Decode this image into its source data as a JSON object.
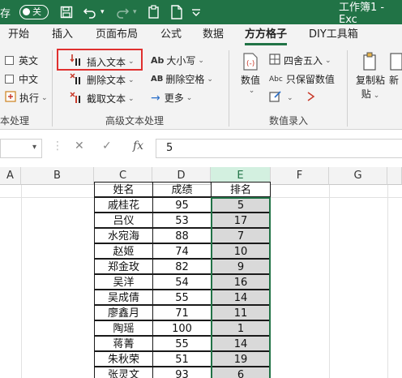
{
  "titlebar": {
    "autosave_label": "存",
    "toggle_text": "关",
    "title": "工作簿1 - Exc"
  },
  "tabs": [
    {
      "label": "开始"
    },
    {
      "label": "插入"
    },
    {
      "label": "页面布局"
    },
    {
      "label": "公式"
    },
    {
      "label": "数据"
    },
    {
      "label": "方方格子"
    },
    {
      "label": "DIY工具箱"
    }
  ],
  "ribbon": {
    "check_english": "英文",
    "check_chinese": "中文",
    "execute": "执行",
    "group1_label": "本处理",
    "insert_text": "插入文本",
    "delete_text": "删除文本",
    "extract_text": "截取文本",
    "case": "大小写",
    "delete_space": "删除空格",
    "more": "更多",
    "group2_label": "高级文本处理",
    "numeric_value": "数值",
    "round": "四舍五入",
    "keep_numeric": "只保留数值",
    "group3_label": "数值录入",
    "copy_paste_line1": "复制粘",
    "copy_paste_line2": "贴",
    "new_label": "新"
  },
  "formula_bar": {
    "value": "5"
  },
  "columns": [
    "A",
    "B",
    "C",
    "D",
    "E",
    "F",
    "G"
  ],
  "table": {
    "headers": [
      "姓名",
      "成绩",
      "排名"
    ],
    "rows": [
      [
        "戚桂花",
        "95",
        "5"
      ],
      [
        "吕仪",
        "53",
        "17"
      ],
      [
        "水宛海",
        "88",
        "7"
      ],
      [
        "赵姬",
        "74",
        "10"
      ],
      [
        "郑金玫",
        "82",
        "9"
      ],
      [
        "吴洋",
        "54",
        "16"
      ],
      [
        "吴成倩",
        "55",
        "14"
      ],
      [
        "廖鑫月",
        "71",
        "11"
      ],
      [
        "陶瑶",
        "100",
        "1"
      ],
      [
        "蒋菁",
        "55",
        "14"
      ],
      [
        "朱秋荣",
        "51",
        "19"
      ],
      [
        "张灵文",
        "93",
        "6"
      ]
    ]
  },
  "colors": {
    "brand": "#217346",
    "highlight_box": "#e0302f",
    "rank_fill": "#d9d9d9"
  }
}
